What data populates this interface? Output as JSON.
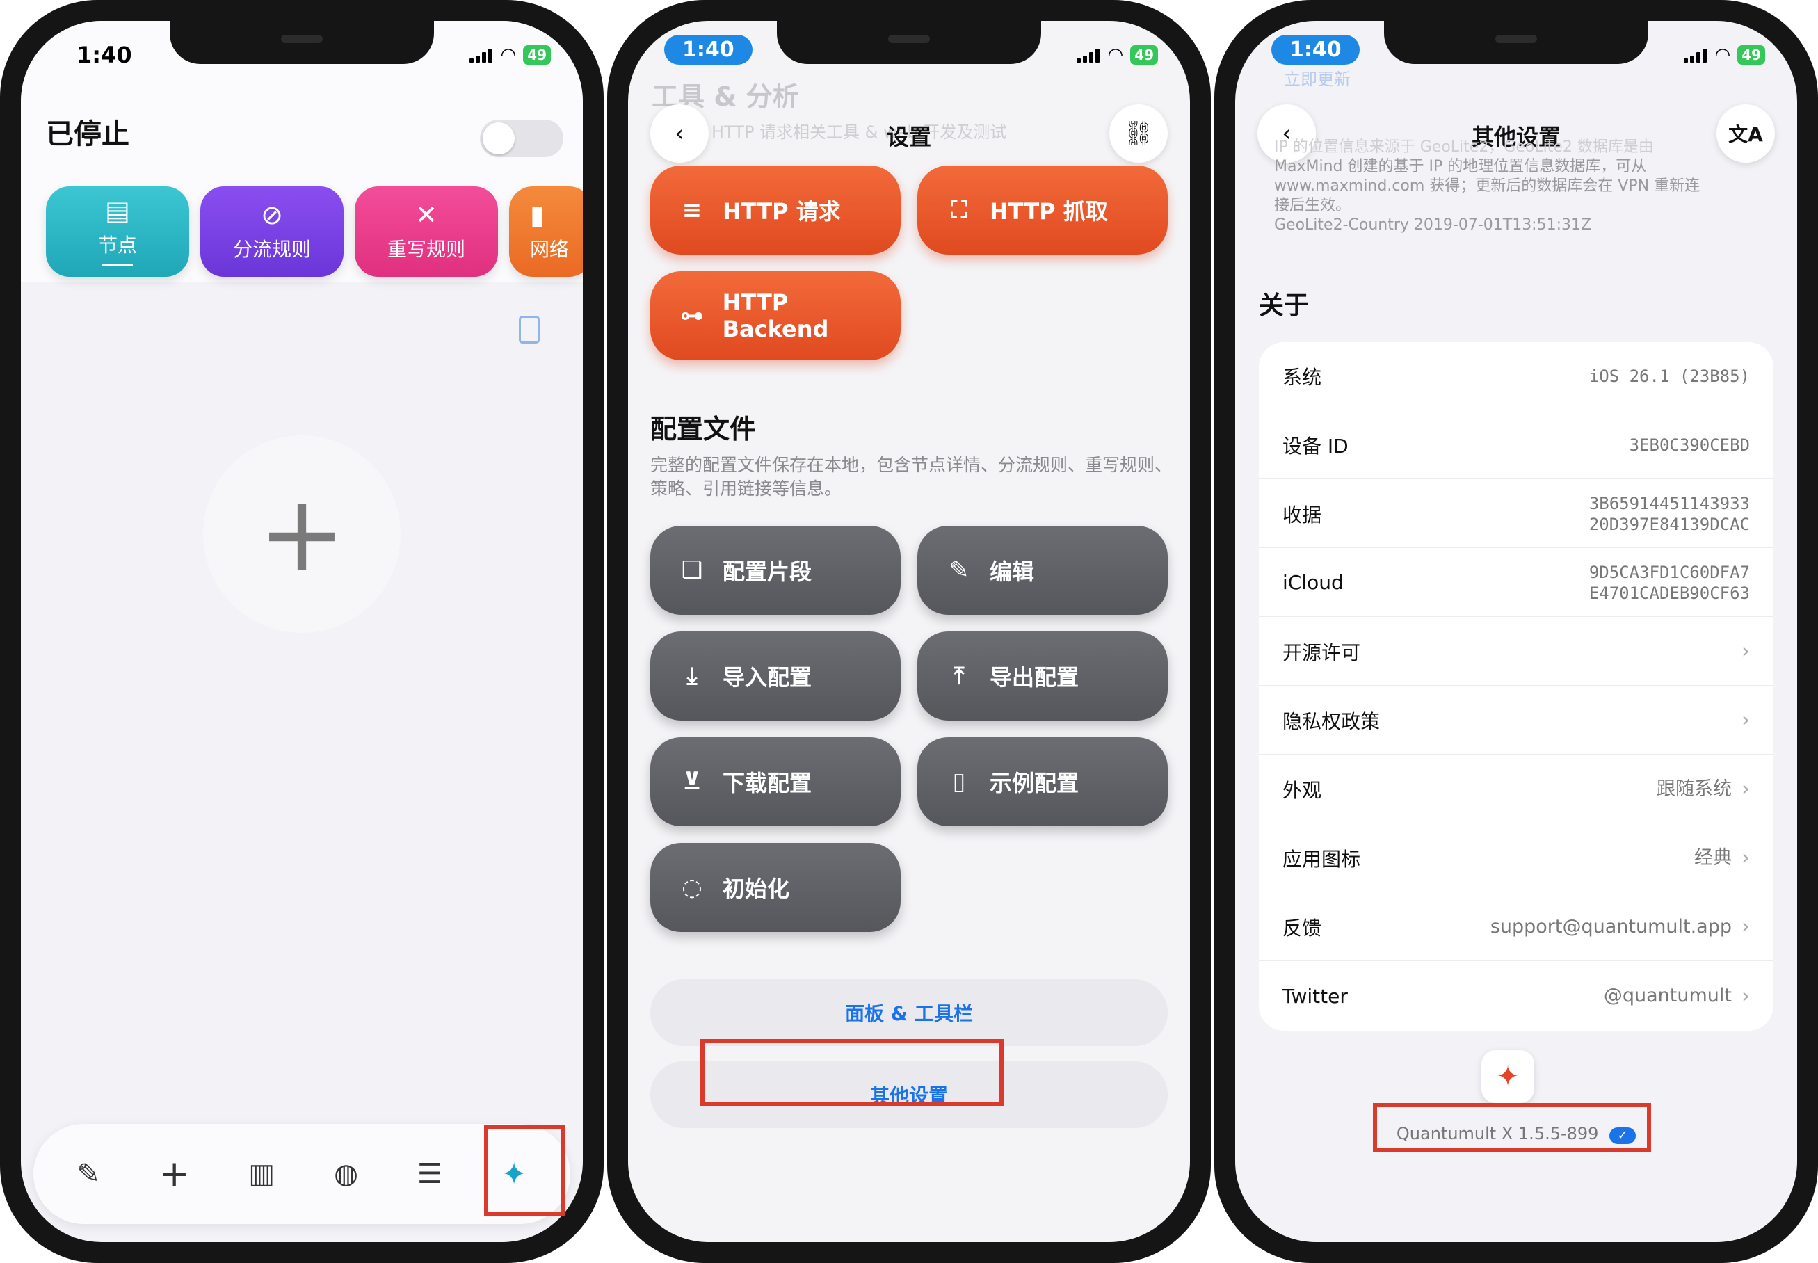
{
  "status": {
    "time": "1:40",
    "battery": "49"
  },
  "home": {
    "title": "已停止",
    "chips": [
      "节点",
      "分流规则",
      "重写规则",
      "网络"
    ],
    "bottom_icons": [
      "compose-icon",
      "plus-icon",
      "stats-icon",
      "globe-icon",
      "list-icon",
      "app-logo-icon"
    ]
  },
  "settings": {
    "title": "设置",
    "behind_header": "工具 & 分析",
    "behind_text": "HTTP 请求相关工具 & web 开发及测试",
    "http_buttons": [
      "HTTP 请求",
      "HTTP 抓取",
      "HTTP Backend"
    ],
    "section_title": "配置文件",
    "section_desc": "完整的配置文件保存在本地，包含节点详情、分流规则、重写规则、策略、引用链接等信息。",
    "config_buttons": [
      "配置片段",
      "编辑",
      "导入配置",
      "导出配置",
      "下载配置",
      "示例配置",
      "初始化"
    ],
    "panel_button": "面板 & 工具栏",
    "other_button": "其他设置"
  },
  "other": {
    "title": "其他设置",
    "behind_link": "立即更新",
    "geo_text1": "IP 的位置信息来源于 GeoLite2，GeoLite2 数据库是由",
    "geo_text2": "MaxMind 创建的基于 IP 的地理位置信息数据库，可从",
    "geo_text3": "www.maxmind.com 获得；更新后的数据库会在 VPN 重新连",
    "geo_text4": "接后生效。",
    "geo_version": "GeoLite2-Country 2019-07-01T13:51:31Z",
    "about": "关于",
    "rows": [
      {
        "label": "系统",
        "value": "iOS 26.1 (23B85)",
        "chev": ""
      },
      {
        "label": "设备 ID",
        "value": "3EB0C390CEBD",
        "chev": ""
      },
      {
        "label": "收据",
        "value": "3B65914451143933",
        "value2": "20D397E84139DCAC",
        "chev": ""
      },
      {
        "label": "iCloud",
        "value": "9D5CA3FD1C60DFA7",
        "value2": "E4701CADEB90CF63",
        "chev": ""
      },
      {
        "label": "开源许可",
        "value": "",
        "chev": "›"
      },
      {
        "label": "隐私权政策",
        "value": "",
        "chev": "›"
      },
      {
        "label": "外观",
        "value": "跟随系统",
        "chev": "›"
      },
      {
        "label": "应用图标",
        "value": "经典",
        "chev": "›"
      },
      {
        "label": "反馈",
        "value": "support@quantumult.app",
        "chev": "›"
      },
      {
        "label": "Twitter",
        "value": "@quantumult",
        "chev": "›"
      }
    ],
    "version": "Quantumult X 1.5.5-899"
  },
  "colors": {
    "accent_red": "#e04a20",
    "highlight_red": "#d93a2b",
    "link_blue": "#1a73e8"
  }
}
